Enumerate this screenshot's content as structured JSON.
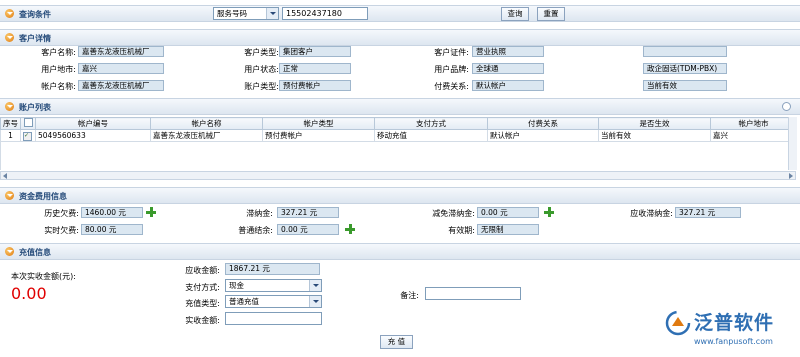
{
  "query": {
    "title": "查询条件",
    "select_value": "服务号码",
    "input_value": "15502437180",
    "query_button": "查询",
    "reset_button": "重置"
  },
  "customer": {
    "title": "客户详情",
    "name_label": "客户名称:",
    "name_value": "嘉善东龙液压机械厂",
    "type_label": "客户类型:",
    "type_value": "集团客户",
    "cert_label": "客户证件:",
    "cert_value": "营业执照",
    "extra_value": "",
    "loc_label": "用户地市:",
    "loc_value": "嘉兴",
    "status_label": "用户状态:",
    "status_value": "正常",
    "brand_label": "用户品牌:",
    "brand_value": "全球通",
    "package_value": "政企固话(TDM-PBX)",
    "acct_name_label": "帐户名称:",
    "acct_name_value": "嘉善东龙液压机械厂",
    "acct_type_label": "账户类型:",
    "acct_type_value": "预付费帐户",
    "pay_rel_label": "付费关系:",
    "pay_rel_value": "默认帐户",
    "effect_value": "当前有效"
  },
  "accounts": {
    "title": "账户列表",
    "columns": [
      "序号",
      "",
      "帐户编号",
      "帐户名称",
      "帐户类型",
      "支付方式",
      "付费关系",
      "是否生效",
      "帐户地市"
    ],
    "rows": [
      [
        "1",
        "",
        "5049560633",
        "嘉善东龙液压机械厂",
        "预付费帐户",
        "移动充值",
        "默认帐户",
        "当前有效",
        "嘉兴"
      ]
    ]
  },
  "fees": {
    "title": "资金费用信息",
    "history_label": "历史欠费:",
    "history_value": "1460.00 元",
    "latefee_label": "滞纳金:",
    "latefee_value": "327.21 元",
    "reduce_label": "减免滞纳金:",
    "reduce_value": "0.00 元",
    "due_latefee_label": "应收滞纳金:",
    "due_latefee_value": "327.21 元",
    "realtime_label": "实时欠费:",
    "realtime_value": "80.00 元",
    "balance_label": "普通结余:",
    "balance_value": "0.00 元",
    "valid_label": "有效期:",
    "valid_value": "无限制"
  },
  "recharge": {
    "title": "充值信息",
    "amount_label": "本次实收金额(元):",
    "amount_value": "0.00",
    "due_label": "应收金额:",
    "due_value": "1867.21 元",
    "paymethod_label": "支付方式:",
    "paymethod_value": "现金",
    "type_label": "充值类型:",
    "type_value": "普通充值",
    "actual_label": "实收金额:",
    "actual_value": "",
    "remark_label": "备注:",
    "remark_value": "",
    "submit_button": "充 值"
  },
  "watermark": {
    "brand": "泛普软件",
    "url": "www.fanpusoft.com"
  },
  "colors": {
    "accent": "#254b7a",
    "amount_red": "#e00000",
    "readonly_bg": "#dbe7f1"
  }
}
